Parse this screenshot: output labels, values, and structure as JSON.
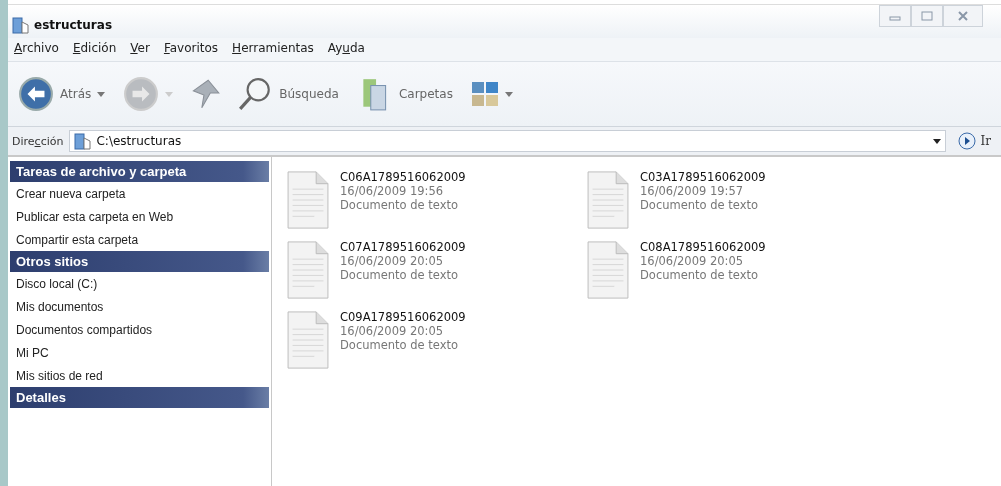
{
  "window": {
    "title": "estructuras"
  },
  "menu": [
    {
      "key": "A",
      "post": "rchivo"
    },
    {
      "key": "E",
      "post": "dición"
    },
    {
      "key": "V",
      "post": "er"
    },
    {
      "key": "F",
      "post": "avoritos"
    },
    {
      "key": "H",
      "post": "erramientas"
    },
    {
      "pre": "Ay",
      "key": "u",
      "post": "da"
    }
  ],
  "toolbar": {
    "back": "Atrás",
    "search": "Búsqueda",
    "folders": "Carpetas"
  },
  "address": {
    "label": {
      "pre": "Dire",
      "key": "c",
      "post": "ción"
    },
    "value": "C:\\estructuras",
    "go": "Ir"
  },
  "sidebar": [
    {
      "title": "Tareas de archivo y carpeta",
      "items": [
        "Crear nueva carpeta",
        "Publicar esta carpeta en Web",
        "Compartir esta carpeta"
      ]
    },
    {
      "title": "Otros sitios",
      "items": [
        "Disco local (C:)",
        "Mis documentos",
        "Documentos compartidos",
        "Mi PC",
        "Mis sitios de red"
      ]
    },
    {
      "title": "Detalles"
    }
  ],
  "files": [
    {
      "name": "C06A1789516062009",
      "date": "16/06/2009 19:56",
      "type": "Documento de texto"
    },
    {
      "name": "C03A1789516062009",
      "date": "16/06/2009 19:57",
      "type": "Documento de texto"
    },
    {
      "name": "C07A1789516062009",
      "date": "16/06/2009 20:05",
      "type": "Documento de texto"
    },
    {
      "name": "C08A1789516062009",
      "date": "16/06/2009 20:05",
      "type": "Documento de texto"
    },
    {
      "name": "C09A1789516062009",
      "date": "16/06/2009 20:05",
      "type": "Documento de texto"
    }
  ]
}
